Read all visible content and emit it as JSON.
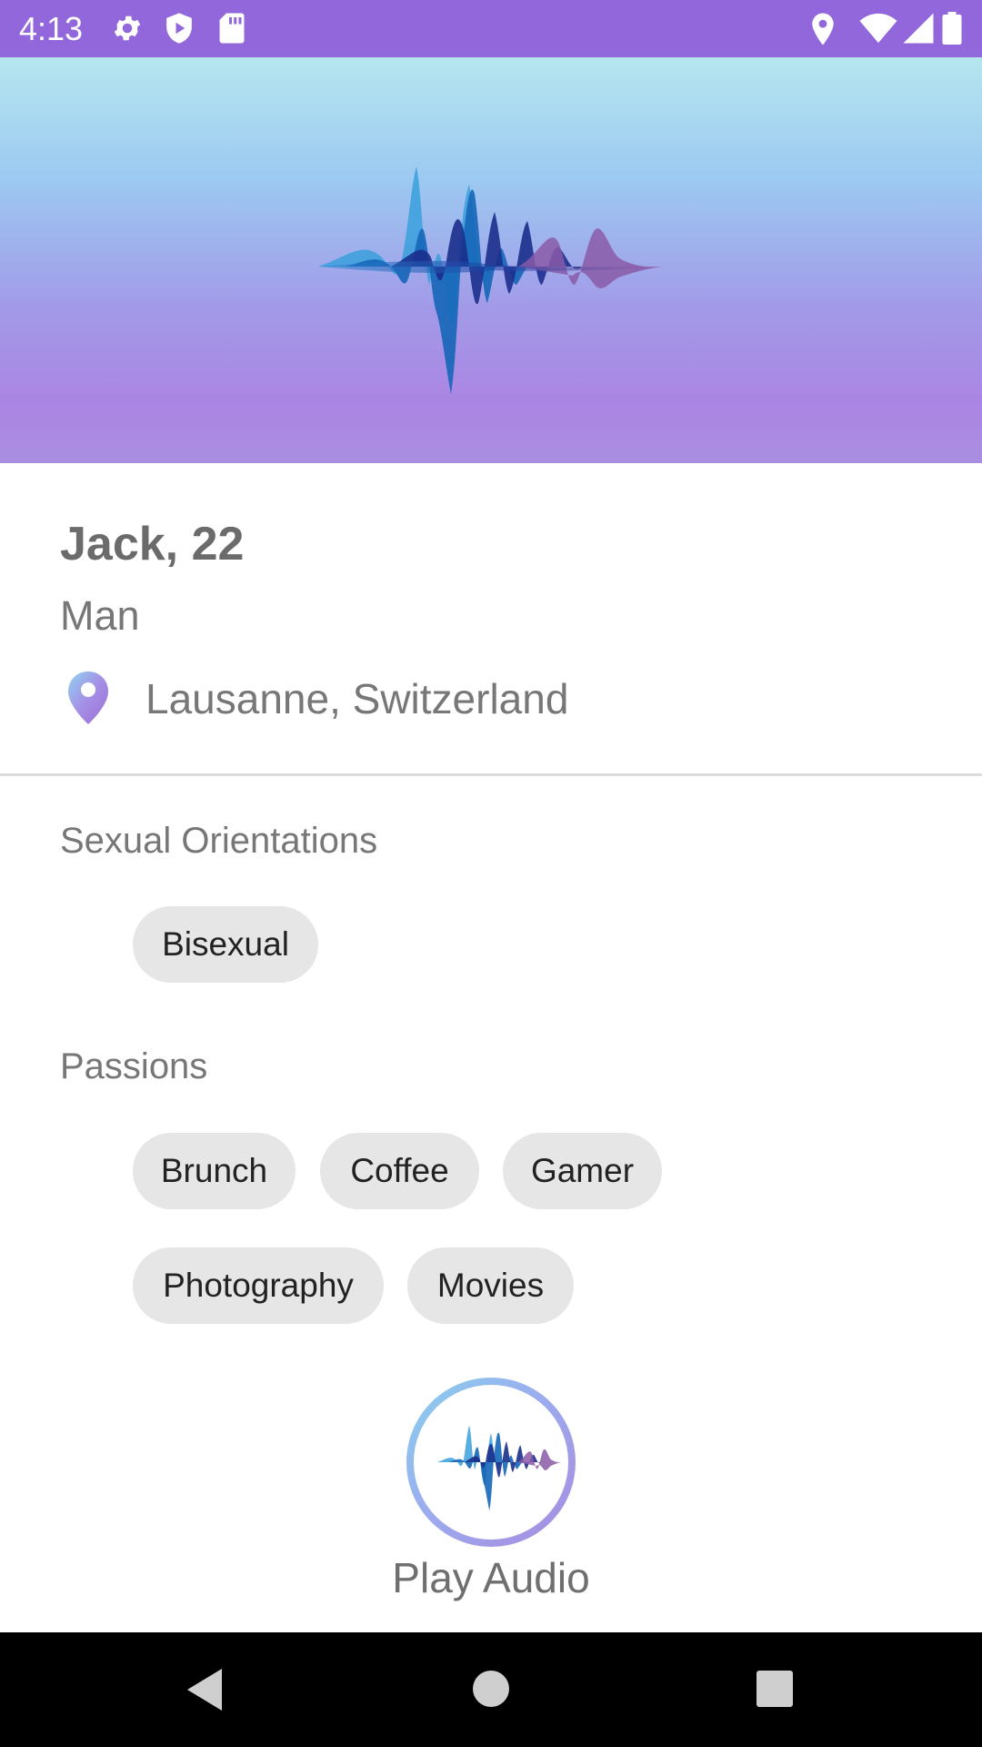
{
  "status_bar": {
    "time": "4:13",
    "background": "#9167db",
    "left_icons": [
      "gear-icon",
      "shield-play-icon",
      "sd-card-icon"
    ],
    "right_icons": [
      "location-icon",
      "wifi-icon",
      "signal-icon",
      "battery-icon"
    ]
  },
  "banner": {
    "gradient_colors": [
      "#b5e6ef",
      "#9cc9f1",
      "#a29ae8",
      "#ab85e3"
    ],
    "logo": "sound-wave-logo"
  },
  "profile": {
    "name_age": "Jack, 22",
    "gender": "Man",
    "location": "Lausanne, Switzerland"
  },
  "sections": {
    "orientations_title": "Sexual Orientations",
    "orientations": [
      "Bisexual"
    ],
    "passions_title": "Passions",
    "passions": [
      "Brunch",
      "Coffee",
      "Gamer",
      "Photography",
      "Movies"
    ]
  },
  "audio": {
    "label": "Play Audio"
  },
  "nav_bar": {
    "buttons": [
      "back-icon",
      "home-icon",
      "recents-icon"
    ]
  }
}
